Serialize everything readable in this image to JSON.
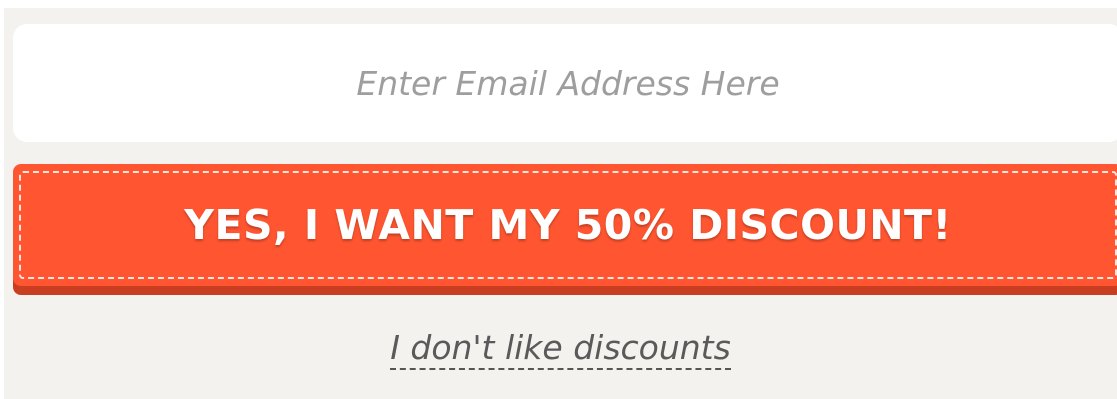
{
  "email": {
    "placeholder": "Enter Email Address Here",
    "value": ""
  },
  "cta": {
    "label": "YES, I WANT MY 50% DISCOUNT!"
  },
  "decline": {
    "label": "I don't like discounts"
  },
  "colors": {
    "panel_background": "#f4f2ef",
    "button_background": "#ff5530",
    "button_shadow": "#c93e20",
    "placeholder_text": "#9e9e9e"
  }
}
